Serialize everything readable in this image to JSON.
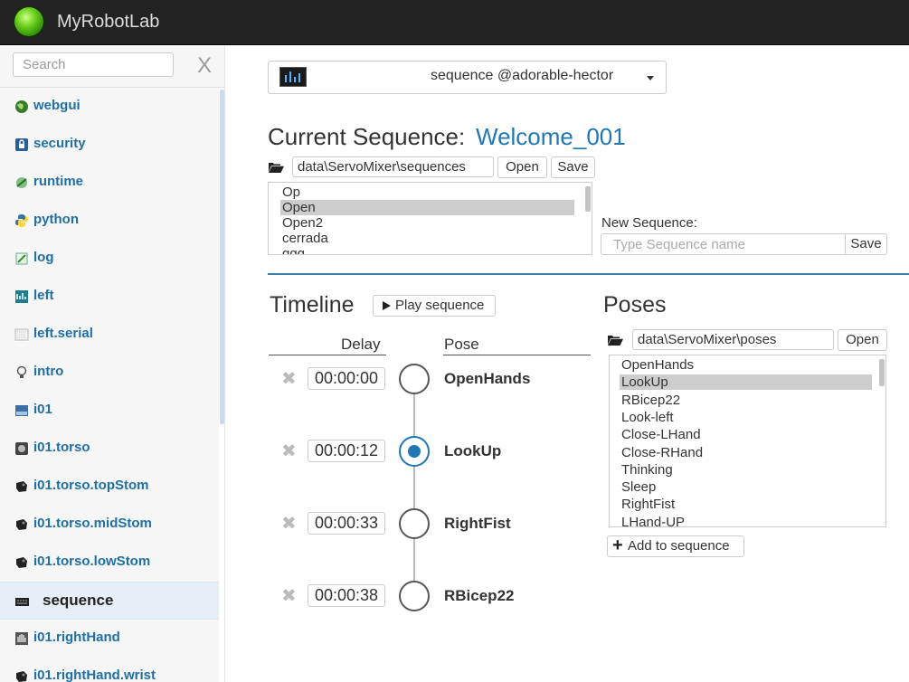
{
  "app": {
    "title": "MyRobotLab"
  },
  "sidebar": {
    "search_placeholder": "Search",
    "close_label": "X",
    "items": [
      {
        "label": "webgui",
        "icon": "globe-icon"
      },
      {
        "label": "security",
        "icon": "lock-icon"
      },
      {
        "label": "runtime",
        "icon": "runtime-icon"
      },
      {
        "label": "python",
        "icon": "python-icon"
      },
      {
        "label": "log",
        "icon": "log-icon"
      },
      {
        "label": "left",
        "icon": "arduino-icon"
      },
      {
        "label": "left.serial",
        "icon": "serial-icon"
      },
      {
        "label": "intro",
        "icon": "bulb-icon"
      },
      {
        "label": "i01",
        "icon": "inmoov-icon"
      },
      {
        "label": "i01.torso",
        "icon": "torso-icon"
      },
      {
        "label": "i01.torso.topStom",
        "icon": "servo-icon"
      },
      {
        "label": "i01.torso.midStom",
        "icon": "servo-icon"
      },
      {
        "label": "i01.torso.lowStom",
        "icon": "servo-icon"
      },
      {
        "label": "sequence",
        "icon": "sequence-icon",
        "active": true
      },
      {
        "label": "i01.rightHand",
        "icon": "hand-icon"
      },
      {
        "label": "i01.rightHand.wrist",
        "icon": "servo-icon"
      }
    ]
  },
  "service_select": {
    "value": "sequence @adorable-hector"
  },
  "current_sequence": {
    "label": "Current Sequence:",
    "name": "Welcome_001",
    "path": "data\\ServoMixer\\sequences",
    "open_label": "Open",
    "save_label": "Save",
    "list": [
      "Op",
      "Open",
      "Open2",
      "cerrada",
      "ggg"
    ],
    "selected_index": 1
  },
  "new_sequence": {
    "label": "New Sequence:",
    "placeholder": "Type Sequence name",
    "save_label": "Save"
  },
  "timeline": {
    "title": "Timeline",
    "play_label": "Play sequence",
    "col_delay": "Delay",
    "col_pose": "Pose",
    "rows": [
      {
        "delay": "00:00:00",
        "pose": "OpenHands",
        "active": false
      },
      {
        "delay": "00:00:12",
        "pose": "LookUp",
        "active": true
      },
      {
        "delay": "00:00:33",
        "pose": "RightFist",
        "active": false
      },
      {
        "delay": "00:00:38",
        "pose": "RBicep22",
        "active": false
      }
    ]
  },
  "poses": {
    "title": "Poses",
    "path": "data\\ServoMixer\\poses",
    "open_label": "Open",
    "list": [
      "OpenHands",
      "LookUp",
      "RBicep22",
      "Look-left",
      "Close-LHand",
      "Close-RHand",
      "Thinking",
      "Sleep",
      "RightFist",
      "LHand-UP"
    ],
    "selected_index": 1,
    "add_label": "Add to sequence"
  }
}
